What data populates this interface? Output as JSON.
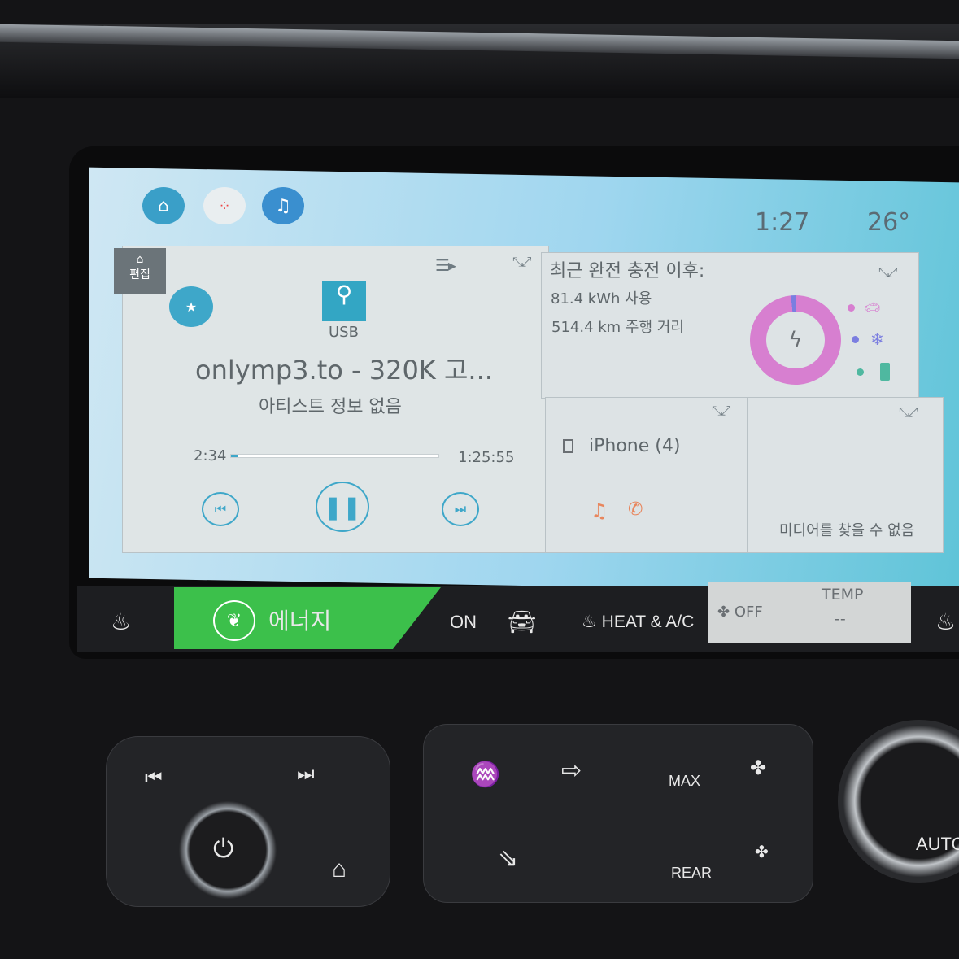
{
  "status": {
    "time": "1:27",
    "temperature": "26°"
  },
  "topbar": {
    "icons": [
      "home-icon",
      "apps-icon",
      "now-playing-icon"
    ]
  },
  "media": {
    "edit_label": "편집",
    "source": "USB",
    "title": "onlymp3.to - 320K 고...",
    "artist": "아티스트 정보 없음",
    "elapsed": "2:34",
    "duration": "1:25:55",
    "progress_percent": 3
  },
  "energy": {
    "heading": "최근 완전 충전 이후:",
    "used": "81.4 kWh 사용",
    "distance": "514.4 km 주행 거리",
    "donut": [
      {
        "label": "driving",
        "percent": 97,
        "color": "#d77fd0"
      },
      {
        "label": "climate",
        "percent": 2,
        "color": "#7b7ee0"
      },
      {
        "label": "battery",
        "percent": 1,
        "color": "#4fb8a0"
      }
    ]
  },
  "phone": {
    "device": "iPhone (4)"
  },
  "media2": {
    "status": "미디어를 찾을 수 없음"
  },
  "climate": {
    "energy_label": "에너지",
    "on_label": "ON",
    "heat_ac_label": "HEAT & A/C",
    "fan_label": "OFF",
    "temp_label": "TEMP",
    "temp_value": "--",
    "accent": "#3cc04b"
  },
  "hardware": {
    "max_label": "MAX",
    "rear_label": "REAR",
    "auto_label": "AUTO"
  }
}
